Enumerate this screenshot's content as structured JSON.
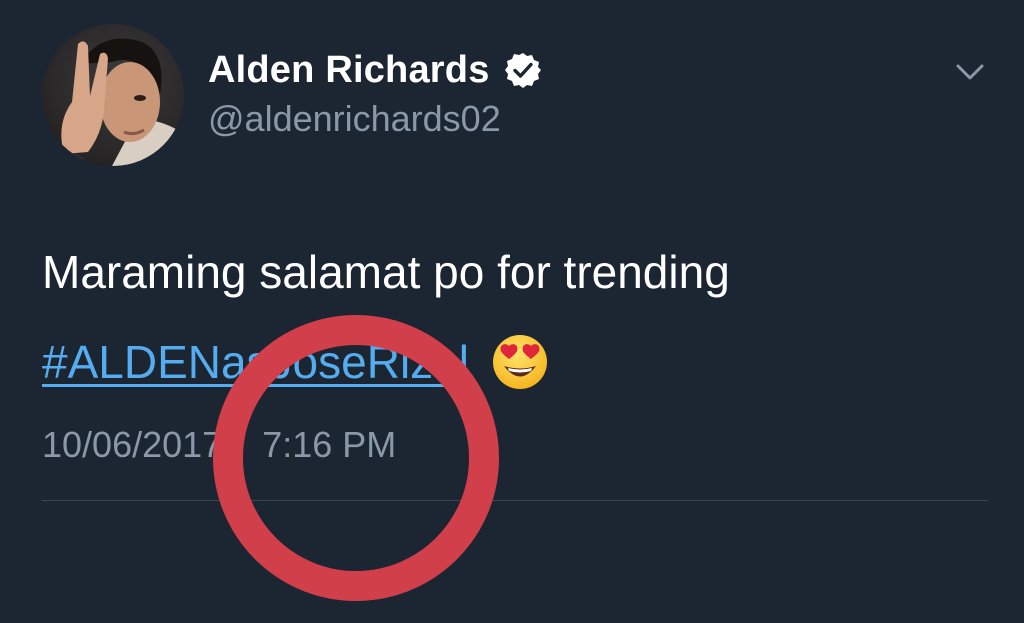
{
  "tweet": {
    "author": {
      "display_name": "Alden Richards",
      "handle": "@aldenrichards02",
      "verified": true
    },
    "text": "Maraming salamat po for trending",
    "hashtag": "#ALDENasJoseRizal",
    "emoji": "heart-eyes-emoji",
    "date": "10/06/2017",
    "time": "7:16 PM"
  },
  "colors": {
    "background": "#1c2532",
    "link": "#55acee",
    "muted": "#8a98a8",
    "annotation": "#d13f4b"
  },
  "icons": {
    "menu": "chevron-down-icon",
    "verified": "verified-badge-icon"
  }
}
